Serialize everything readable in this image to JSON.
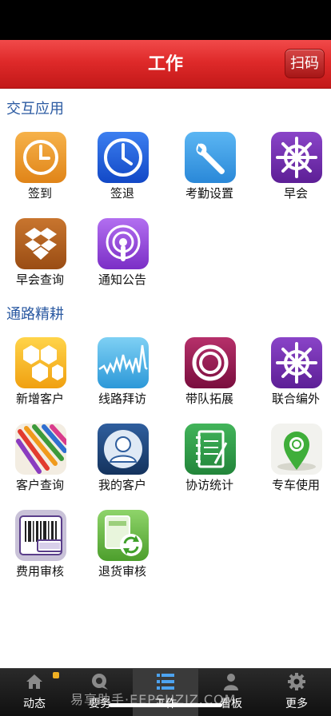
{
  "nav": {
    "title": "工作",
    "scan_label": "扫码"
  },
  "sections": [
    {
      "title": "交互应用",
      "items": [
        {
          "label": "签到",
          "icon": "clock-icon"
        },
        {
          "label": "签退",
          "icon": "clock-icon"
        },
        {
          "label": "考勤设置",
          "icon": "wrench-icon"
        },
        {
          "label": "早会",
          "icon": "helm-icon"
        },
        {
          "label": "早会查询",
          "icon": "box-icon"
        },
        {
          "label": "通知公告",
          "icon": "broadcast-icon"
        }
      ]
    },
    {
      "title": "通路精耕",
      "items": [
        {
          "label": "新增客户",
          "icon": "hexagon-icon"
        },
        {
          "label": "线路拜访",
          "icon": "wave-icon"
        },
        {
          "label": "带队拓展",
          "icon": "ring-icon"
        },
        {
          "label": "联合编外",
          "icon": "helm-icon"
        },
        {
          "label": "客户查询",
          "icon": "pencils-icon"
        },
        {
          "label": "我的客户",
          "icon": "contact-icon"
        },
        {
          "label": "协访统计",
          "icon": "notebook-icon"
        },
        {
          "label": "专车使用",
          "icon": "map-pin-icon"
        },
        {
          "label": "费用审核",
          "icon": "barcode-icon"
        },
        {
          "label": "退货审核",
          "icon": "refresh-icon"
        }
      ]
    }
  ],
  "tabs": [
    {
      "label": "动态",
      "icon": "home-icon"
    },
    {
      "label": "要务",
      "icon": "chat-icon"
    },
    {
      "label": "工作",
      "icon": "list-icon"
    },
    {
      "label": "看板",
      "icon": "person-icon"
    },
    {
      "label": "更多",
      "icon": "gear-icon"
    }
  ],
  "watermark": "易享助手·EEPSHZJZ.COM",
  "colors": {
    "nav_red": "#df2a2a",
    "section_blue": "#2b5aa2",
    "tab_bar": "#1a1a1a",
    "badge": "#f0b023"
  }
}
